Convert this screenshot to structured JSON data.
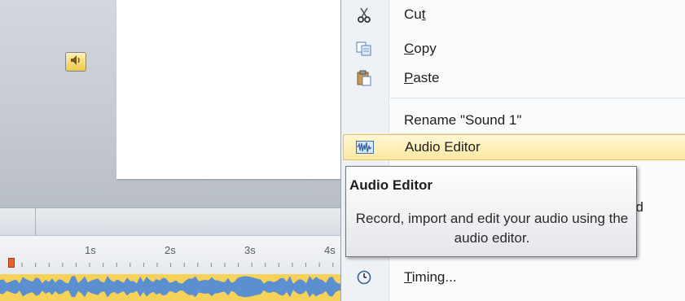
{
  "menu": {
    "items": [
      {
        "label": "Cut",
        "icon": "scissors-icon"
      },
      {
        "label": "Copy",
        "icon": "copy-icon"
      },
      {
        "label": "Paste",
        "icon": "paste-icon"
      },
      {
        "label": "Rename \"Sound 1\"",
        "icon": ""
      },
      {
        "label": "Audio Editor",
        "icon": "audio-editor-icon"
      },
      {
        "label": "Timing...",
        "icon": "clock-icon"
      }
    ],
    "partial_item_suffix": "ad"
  },
  "tooltip": {
    "title": "Audio Editor",
    "body": "Record, import and edit your audio using the audio editor."
  },
  "timeline": {
    "tick_labels": [
      "1s",
      "2s",
      "3s",
      "4s"
    ]
  },
  "slide": {
    "sound_object_icon": "speaker-icon"
  },
  "colors": {
    "highlight": "#fde9a2",
    "waveform": "#5b8fcf",
    "waveform_background": "#f7d25a",
    "playhead": "#e8632b"
  }
}
